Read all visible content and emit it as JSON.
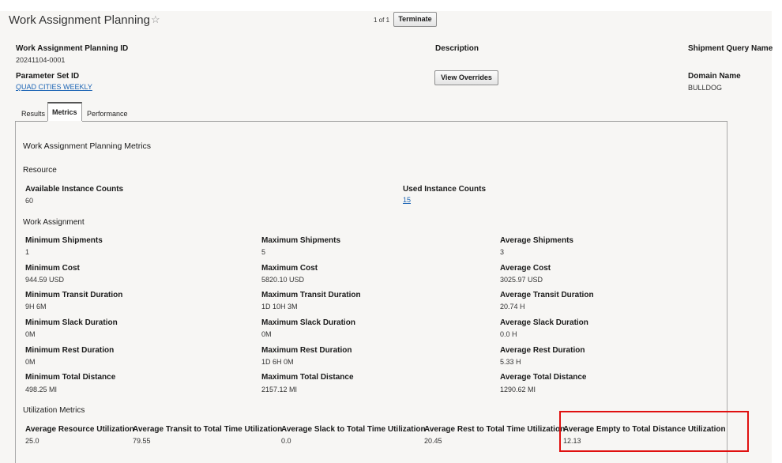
{
  "header": {
    "title": "Work Assignment Planning",
    "star": "☆",
    "pager": "1 of 1",
    "terminate_label": "Terminate"
  },
  "info": {
    "wap_id_label": "Work Assignment Planning ID",
    "wap_id_value": "20241104-0001",
    "description_label": "Description",
    "shipment_query_label": "Shipment Query Name",
    "param_set_label": "Parameter Set ID",
    "param_set_value": "QUAD CITIES WEEKLY",
    "view_overrides_label": "View Overrides",
    "domain_label": "Domain Name",
    "domain_value": "BULLDOG"
  },
  "tabs": [
    "Results",
    "Metrics",
    "Performance"
  ],
  "active_tab": "Metrics",
  "metrics": {
    "title": "Work Assignment Planning Metrics",
    "resource": {
      "title": "Resource",
      "available_label": "Available Instance Counts",
      "available_value": "60",
      "used_label": "Used Instance Counts",
      "used_value": "15"
    },
    "work_assignment": {
      "title": "Work Assignment",
      "rows": [
        [
          {
            "label": "Minimum Shipments",
            "value": "1"
          },
          {
            "label": "Maximum Shipments",
            "value": "5"
          },
          {
            "label": "Average Shipments",
            "value": "3"
          }
        ],
        [
          {
            "label": "Minimum Cost",
            "value": "944.59 USD"
          },
          {
            "label": "Maximum Cost",
            "value": "5820.10 USD"
          },
          {
            "label": "Average Cost",
            "value": "3025.97 USD"
          }
        ],
        [
          {
            "label": "Minimum Transit Duration",
            "value": "9H 6M"
          },
          {
            "label": "Maximum Transit Duration",
            "value": "1D 10H 3M"
          },
          {
            "label": "Average Transit Duration",
            "value": "20.74 H"
          }
        ],
        [
          {
            "label": "Minimum Slack Duration",
            "value": "0M"
          },
          {
            "label": "Maximum Slack Duration",
            "value": "0M"
          },
          {
            "label": "Average Slack Duration",
            "value": "0.0 H"
          }
        ],
        [
          {
            "label": "Minimum Rest Duration",
            "value": "0M"
          },
          {
            "label": "Maximum Rest Duration",
            "value": "1D 6H 0M"
          },
          {
            "label": "Average Rest Duration",
            "value": "5.33 H"
          }
        ],
        [
          {
            "label": "Minimum Total Distance",
            "value": "498.25 MI"
          },
          {
            "label": "Maximum Total Distance",
            "value": "2157.12 MI"
          },
          {
            "label": "Average Total Distance",
            "value": "1290.62 MI"
          }
        ]
      ]
    },
    "utilization": {
      "title": "Utilization Metrics",
      "items": [
        {
          "label": "Average Resource Utilization",
          "value": "25.0"
        },
        {
          "label": "Average Transit to Total Time Utilization",
          "value": "79.55"
        },
        {
          "label": "Average Slack to Total Time Utilization",
          "value": "0.0"
        },
        {
          "label": "Average Rest to Total Time Utilization",
          "value": "20.45"
        },
        {
          "label": "Average Empty to Total Distance Utilization",
          "value": "12.13"
        }
      ]
    }
  },
  "colors": {
    "highlight": "#e01010",
    "link": "#1c64b4",
    "panel_bg": "#f7f6f4"
  }
}
